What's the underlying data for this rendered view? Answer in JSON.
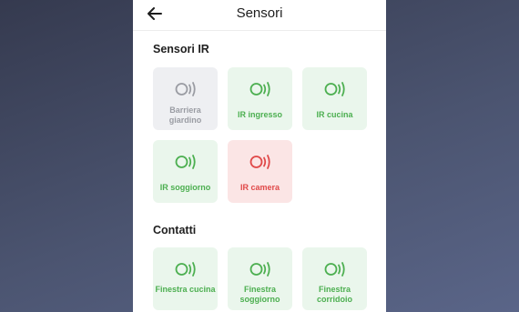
{
  "header": {
    "title": "Sensori"
  },
  "sections": {
    "ir": {
      "title": "Sensori IR",
      "tiles": [
        {
          "label": "Barriera giardino",
          "state": "inactive"
        },
        {
          "label": "IR ingresso",
          "state": "ok"
        },
        {
          "label": "IR cucina",
          "state": "ok"
        },
        {
          "label": "IR soggiorno",
          "state": "ok"
        },
        {
          "label": "IR camera",
          "state": "alarm",
          "badge": "!"
        }
      ]
    },
    "contacts": {
      "title": "Contatti",
      "tiles": [
        {
          "label": "Finestra cucina",
          "state": "ok"
        },
        {
          "label": "Finestra soggiorno",
          "state": "ok"
        },
        {
          "label": "Finestra corridoio",
          "state": "ok"
        }
      ]
    }
  },
  "colors": {
    "ok": "#4caf50",
    "inactive": "#9a9ca3",
    "alarm": "#e04848"
  },
  "icons": {
    "back": "arrow-left-icon",
    "sensor": "sensor-signal-icon"
  }
}
